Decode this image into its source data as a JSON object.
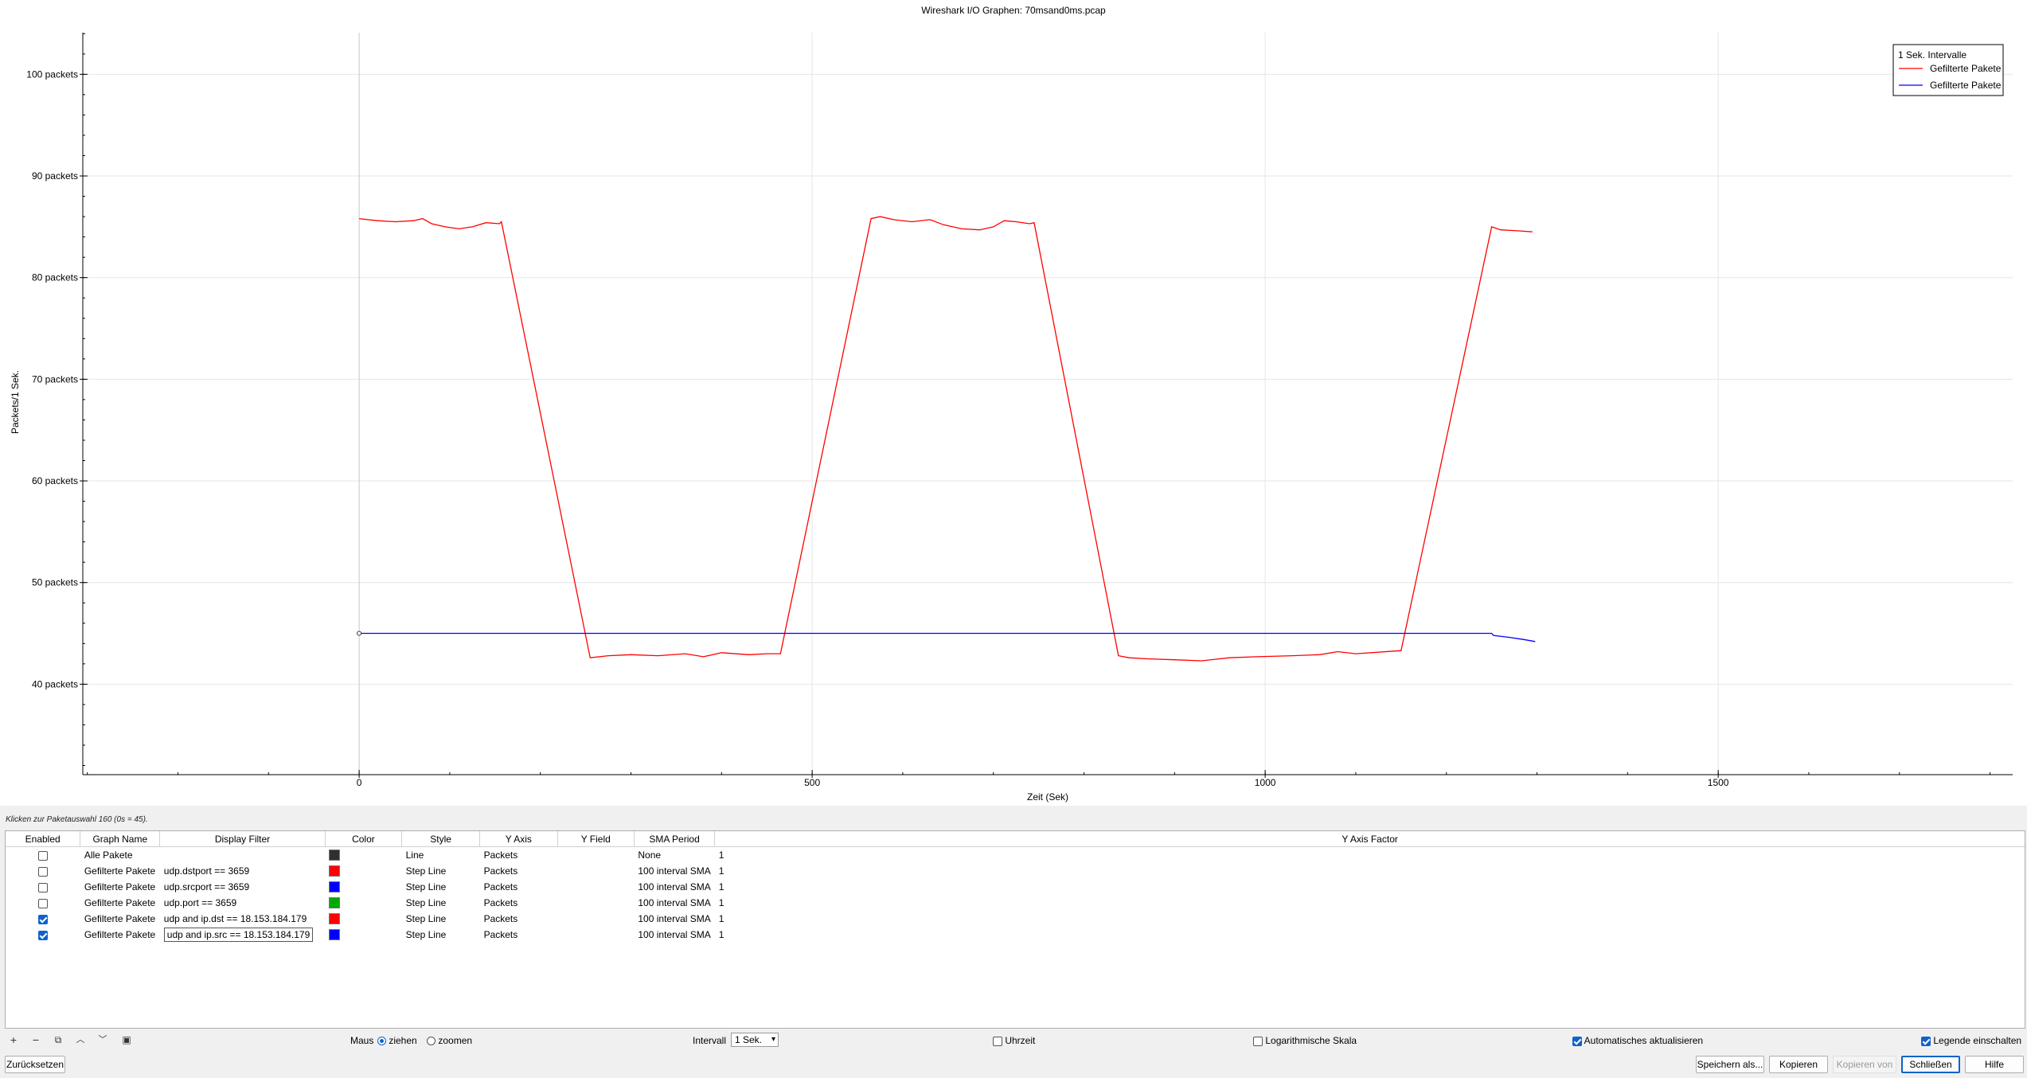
{
  "window": {
    "title": "Wireshark I/O Graphen: 70msand0ms.pcap"
  },
  "chart_data": {
    "type": "line",
    "title": "Wireshark I/O Graphen: 70msand0ms.pcap",
    "xlabel": "Zeit (Sek)",
    "ylabel": "Packets/1 Sek.",
    "xlim": [
      -305,
      1825
    ],
    "ylim": [
      31.1,
      104.1
    ],
    "x_ticks": [
      0,
      500,
      1000,
      1500
    ],
    "x_tick_labels": [
      "0",
      "500",
      "1000",
      "1500"
    ],
    "y_ticks": [
      40,
      50,
      60,
      70,
      80,
      90,
      100
    ],
    "y_tick_labels": [
      "40 packets",
      "50 packets",
      "60 packets",
      "70 packets",
      "80 packets",
      "90 packets",
      "100 packets"
    ],
    "grid": true,
    "legend_position": "top-right",
    "legend_title": "1 Sek. Intervalle",
    "series": [
      {
        "name": "Gefilterte Pakete",
        "color": "#ff0000",
        "points": [
          [
            0,
            85.8
          ],
          [
            20,
            85.6
          ],
          [
            40,
            85.5
          ],
          [
            60,
            85.6
          ],
          [
            70,
            85.8
          ],
          [
            80,
            85.3
          ],
          [
            95,
            85.0
          ],
          [
            110,
            84.8
          ],
          [
            125,
            85.0
          ],
          [
            140,
            85.4
          ],
          [
            155,
            85.3
          ],
          [
            157,
            85.5
          ],
          [
            255,
            42.6
          ],
          [
            275,
            42.8
          ],
          [
            300,
            42.9
          ],
          [
            330,
            42.8
          ],
          [
            360,
            43.0
          ],
          [
            380,
            42.7
          ],
          [
            400,
            43.1
          ],
          [
            430,
            42.9
          ],
          [
            450,
            43.0
          ],
          [
            465,
            43.0
          ],
          [
            565,
            85.8
          ],
          [
            575,
            86.0
          ],
          [
            590,
            85.7
          ],
          [
            610,
            85.5
          ],
          [
            630,
            85.7
          ],
          [
            645,
            85.2
          ],
          [
            665,
            84.8
          ],
          [
            685,
            84.7
          ],
          [
            700,
            85.0
          ],
          [
            712,
            85.6
          ],
          [
            725,
            85.5
          ],
          [
            740,
            85.3
          ],
          [
            745,
            85.4
          ],
          [
            838,
            42.8
          ],
          [
            850,
            42.6
          ],
          [
            870,
            42.5
          ],
          [
            900,
            42.4
          ],
          [
            930,
            42.3
          ],
          [
            960,
            42.6
          ],
          [
            990,
            42.7
          ],
          [
            1030,
            42.8
          ],
          [
            1060,
            42.9
          ],
          [
            1080,
            43.2
          ],
          [
            1100,
            43.0
          ],
          [
            1150,
            43.3
          ],
          [
            1250,
            85.0
          ],
          [
            1260,
            84.7
          ],
          [
            1280,
            84.6
          ],
          [
            1295,
            84.5
          ]
        ]
      },
      {
        "name": "Gefilterte Pakete",
        "color": "#0000ff",
        "points": [
          [
            0,
            45
          ],
          [
            1250,
            45
          ],
          [
            1252,
            44.8
          ],
          [
            1270,
            44.6
          ],
          [
            1285,
            44.4
          ],
          [
            1298,
            44.2
          ]
        ]
      }
    ],
    "marker": {
      "x": 0,
      "y": 45
    }
  },
  "status_text": "Klicken zur Paketauswahl 160 (0s = 45).",
  "table": {
    "headers": [
      "Enabled",
      "Graph Name",
      "Display Filter",
      "Color",
      "Style",
      "Y Axis",
      "Y Field",
      "SMA Period",
      "Y Axis Factor"
    ],
    "rows": [
      {
        "enabled": false,
        "name": "Alle Pakete",
        "filter": "",
        "color": "#303030",
        "style": "Line",
        "y_axis": "Packets",
        "y_field": "",
        "sma": "None",
        "factor": "1"
      },
      {
        "enabled": false,
        "name": "Gefilterte Pakete",
        "filter": "udp.dstport == 3659",
        "color": "#ff0000",
        "style": "Step Line",
        "y_axis": "Packets",
        "y_field": "",
        "sma": "100 interval SMA",
        "factor": "1"
      },
      {
        "enabled": false,
        "name": "Gefilterte Pakete",
        "filter": "udp.srcport == 3659",
        "color": "#0000ff",
        "style": "Step Line",
        "y_axis": "Packets",
        "y_field": "",
        "sma": "100 interval SMA",
        "factor": "1"
      },
      {
        "enabled": false,
        "name": "Gefilterte Pakete",
        "filter": "udp.port == 3659",
        "color": "#00aa00",
        "style": "Step Line",
        "y_axis": "Packets",
        "y_field": "",
        "sma": "100 interval SMA",
        "factor": "1"
      },
      {
        "enabled": true,
        "name": "Gefilterte Pakete",
        "filter": "udp and ip.dst == 18.153.184.179",
        "color": "#ff0000",
        "style": "Step Line",
        "y_axis": "Packets",
        "y_field": "",
        "sma": "100 interval SMA",
        "factor": "1"
      },
      {
        "enabled": true,
        "name": "Gefilterte Pakete",
        "filter": "udp and ip.src == 18.153.184.179",
        "color": "#0000ff",
        "style": "Step Line",
        "y_axis": "Packets",
        "y_field": "",
        "sma": "100 interval SMA",
        "factor": "1"
      }
    ]
  },
  "toolbar": {
    "icons": [
      "add-icon",
      "remove-icon",
      "copy-icon",
      "move-up-icon",
      "move-down-icon",
      "clear-icon"
    ],
    "maus_label": "Maus",
    "ziehen_label": "ziehen",
    "zoomen_label": "zoomen",
    "intervall_label": "Intervall",
    "intervall_value": "1 Sek.",
    "uhrzeit_label": "Uhrzeit",
    "log_label": "Logarithmische Skala",
    "auto_label": "Automatisches aktualisieren",
    "legend_label": "Legende einschalten",
    "uhrzeit_checked": false,
    "log_checked": false,
    "auto_checked": true,
    "legend_checked": true
  },
  "buttons": {
    "reset": "Zurücksetzen",
    "save_as": "Speichern als...",
    "copy": "Kopieren",
    "copy_from": "Kopieren von",
    "close": "Schließen",
    "help": "Hilfe"
  }
}
